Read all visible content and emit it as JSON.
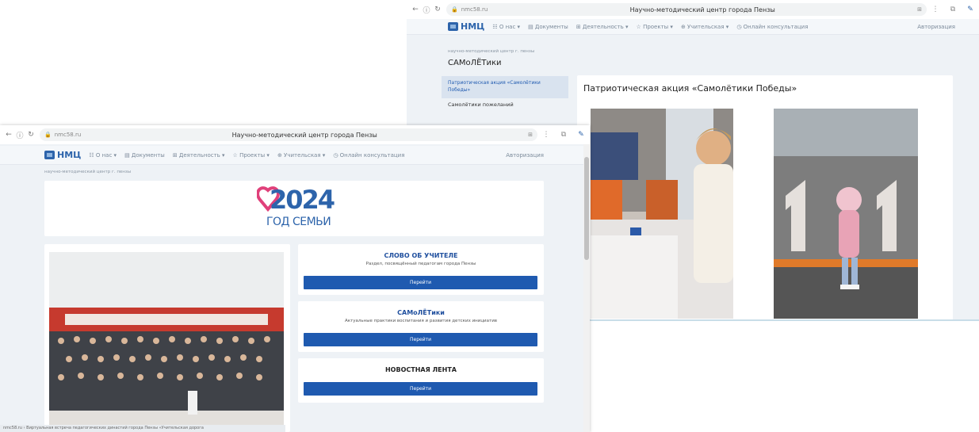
{
  "back_window": {
    "url": "nmc58.ru",
    "page_title": "Научно-методический центр города Пензы",
    "site": {
      "logo": "НМЦ",
      "menu": [
        "О нас",
        "Документы",
        "Деятельность",
        "Проекты",
        "Учительская",
        "Онлайн консультация"
      ],
      "login": "Авторизация"
    },
    "breadcrumb": "научно-методический центр г. пензы",
    "section_title": "САМоЛЁТики",
    "sidebar": {
      "active": "Патриотическая акция «Самолётики Победы»",
      "item2": "Самолётики пожеланий"
    },
    "article_title": "Патриотическая акция «Самолётики Победы»"
  },
  "front_window": {
    "url": "nmc58.ru",
    "page_title": "Научно-методический центр города Пензы",
    "site": {
      "logo": "НМЦ",
      "menu": [
        "О нас",
        "Документы",
        "Деятельность",
        "Проекты",
        "Учительская",
        "Онлайн консультация"
      ],
      "login": "Авторизация"
    },
    "breadcrumb": "научно-методический центр г. пензы",
    "banner": {
      "year": "2024",
      "caption": "ГОД СЕМЬИ"
    },
    "cards": [
      {
        "title": "СЛОВО ОБ УЧИТЕЛЕ",
        "subtitle": "Раздел, посвящённый педагогам города Пензы",
        "button": "Перейти"
      },
      {
        "title": "САМоЛЁТики",
        "subtitle": "Актуальные практики воспитания и развития детских инициатив",
        "button": "Перейти"
      },
      {
        "title": "НОВОСТНАЯ ЛЕНТА",
        "subtitle": "",
        "button": "Перейти"
      }
    ],
    "status_text": "nmc58.ru › Виртуальная встреча педагогических династий города Пензы «Учительская дорога"
  },
  "colors": {
    "brand": "#2d64ab",
    "button": "#1f5ab0",
    "heart": "#e0407a"
  }
}
